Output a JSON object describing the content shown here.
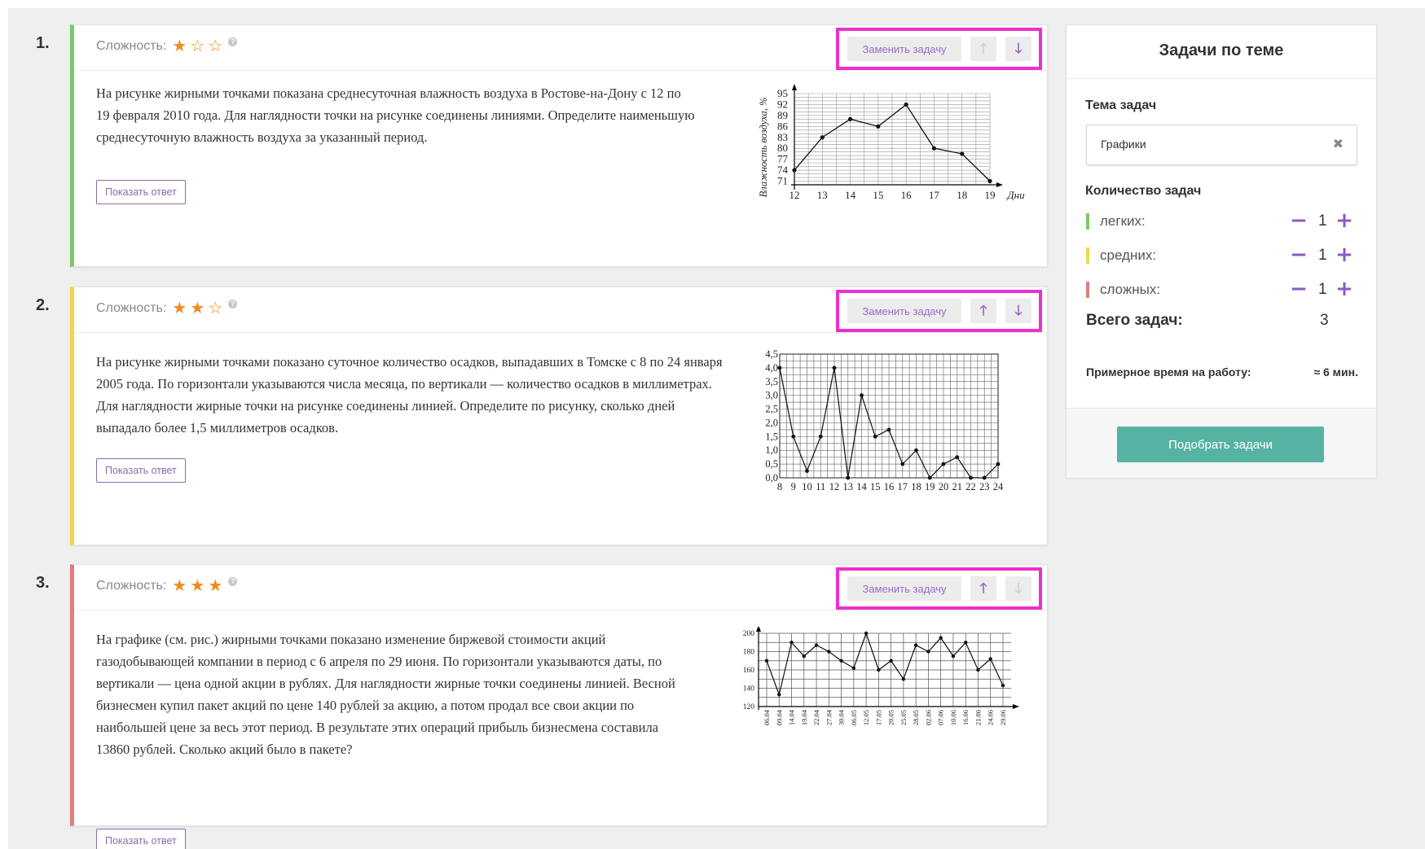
{
  "tasks": [
    {
      "number": "1.",
      "difficulty_label": "Сложность:",
      "stars": 1,
      "replace_label": "Заменить задачу",
      "up_enabled": false,
      "down_enabled": true,
      "text_lines": [
        "На рисунке жирными точками показана среднесуточная влажность воздуха в Ростове-на-Дону с 12 по",
        "19 февраля 2010 года. Для наглядности точки на рисунке соединены линиями. Определите наименьшую",
        "среднесуточную влажность воздуха за указанный период."
      ],
      "show_answer_label": "Показать ответ"
    },
    {
      "number": "2.",
      "difficulty_label": "Сложность:",
      "stars": 2,
      "replace_label": "Заменить задачу",
      "up_enabled": true,
      "down_enabled": true,
      "text_lines": [
        "На рисунке жирными точками показано суточное количество осадков, выпадавших в Томске с 8 по 24 января",
        "2005 года. По горизонтали указываются числа месяца, по вертикали — количество осадков в миллиметрах.",
        "Для наглядности жирные точки на рисунке соединены линией. Определите по рисунку, сколько дней",
        "выпадало более 1,5 миллиметров осадков."
      ],
      "show_answer_label": "Показать ответ"
    },
    {
      "number": "3.",
      "difficulty_label": "Сложность:",
      "stars": 3,
      "replace_label": "Заменить задачу",
      "up_enabled": true,
      "down_enabled": false,
      "text_lines": [
        "На графике (см. рис.) жирными точками показано изменение биржевой стоимости акций",
        "газодобывающей компании в период с 6 апреля по 29 июня. По горизонтали указываются даты, по",
        "вертикали — цена одной акции в рублях. Для наглядности жирные точки соединены линией. Весной",
        "бизнесмен купил пакет акций по цене 140 рублей за акцию, а потом продал все свои акции по",
        "наибольшей цене за весь этот период. В результате этих операций прибыль бизнесмена составила",
        "13860 рублей. Сколько акций было в пакете?"
      ],
      "show_answer_label": "Показать ответ"
    }
  ],
  "icons": {
    "star_filled": "★",
    "star_empty": "☆",
    "help": "?",
    "arrow_up": "🡑",
    "arrow_down": "🡓",
    "clear": "✖"
  },
  "sidebar": {
    "title": "Задачи по теме",
    "topic_label": "Тема задач",
    "topic_value": "Графики",
    "count_label": "Количество задач",
    "levels": [
      {
        "label": "легких:",
        "value": "1",
        "color": "#7cc86a"
      },
      {
        "label": "средних:",
        "value": "1",
        "color": "#f0d84a"
      },
      {
        "label": "сложных:",
        "value": "1",
        "color": "#e07d7d"
      }
    ],
    "total_label": "Всего задач:",
    "total_value": "3",
    "time_label": "Примерное время на работу:",
    "time_value": "≈ 6 мин.",
    "pick_button": "Подобрать задачи"
  },
  "chart_data": [
    {
      "type": "line",
      "ylabel": "Влажность воздуха, %",
      "xlabel": "Дни",
      "x": [
        12,
        13,
        14,
        15,
        16,
        17,
        18,
        19
      ],
      "values": [
        74,
        83,
        88,
        86,
        92,
        80,
        78.5,
        71
      ],
      "yticks": [
        71,
        74,
        77,
        80,
        83,
        86,
        89,
        92,
        95
      ],
      "ylim": [
        70,
        95
      ],
      "grid": true
    },
    {
      "type": "line",
      "xlabel": "",
      "ylabel": "",
      "x": [
        8,
        9,
        10,
        11,
        12,
        13,
        14,
        15,
        16,
        17,
        18,
        19,
        20,
        21,
        22,
        23,
        24
      ],
      "values": [
        4.0,
        1.5,
        0.25,
        1.5,
        4.0,
        0.0,
        3.0,
        1.5,
        1.75,
        0.5,
        1.0,
        0.0,
        0.5,
        0.75,
        0.0,
        0.0,
        0.5
      ],
      "yticks": [
        "0,0",
        "0,5",
        "1,0",
        "1,5",
        "2,0",
        "2,5",
        "3,0",
        "3,5",
        "4,0",
        "4,5"
      ],
      "ylim": [
        0,
        4.5
      ],
      "grid": true
    },
    {
      "type": "line",
      "xlabel": "",
      "ylabel": "",
      "categories": [
        "06.04",
        "09.04",
        "14.04",
        "19.04",
        "22.04",
        "27.04",
        "30.04",
        "06.05",
        "12.05",
        "17.05",
        "20.05",
        "25.05",
        "28.05",
        "02.06",
        "07.06",
        "10.06",
        "16.06",
        "21.06",
        "24.06",
        "29.06"
      ],
      "values": [
        170,
        133,
        190,
        175,
        187,
        180,
        170,
        162,
        200,
        160,
        170,
        150,
        187,
        180,
        195,
        175,
        190,
        160,
        172,
        143
      ],
      "yticks": [
        120,
        140,
        160,
        180,
        200
      ],
      "ylim": [
        120,
        200
      ],
      "grid": true
    }
  ]
}
